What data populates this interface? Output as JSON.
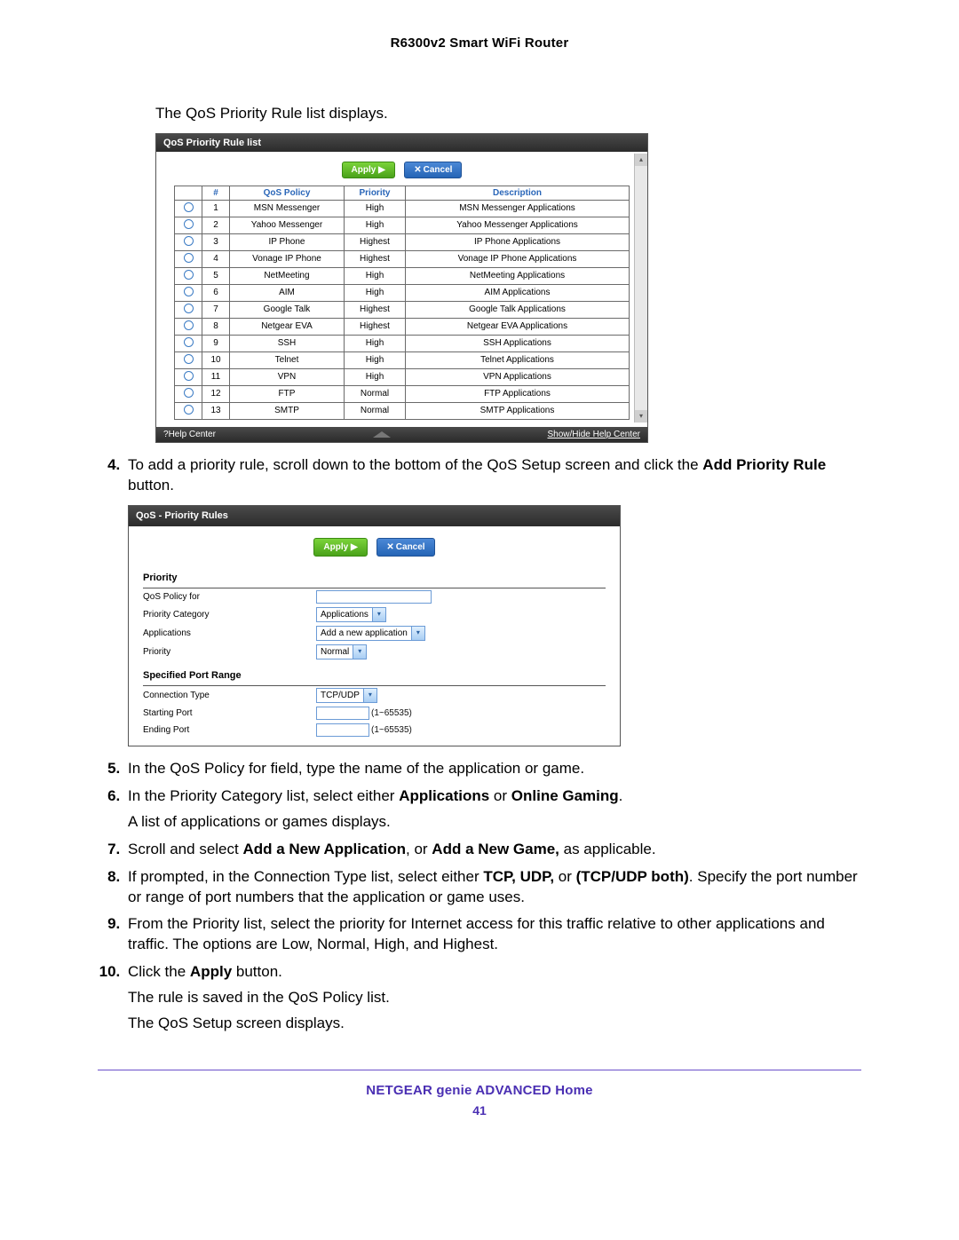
{
  "header": {
    "router_title": "R6300v2 Smart WiFi Router"
  },
  "intro": "The QoS Priority Rule list displays.",
  "shot1": {
    "title": "QoS Priority Rule list",
    "apply": "Apply ▶",
    "cancel": "Cancel",
    "cols": {
      "num": "#",
      "policy": "QoS Policy",
      "priority": "Priority",
      "desc": "Description"
    },
    "rows": [
      {
        "n": "1",
        "policy": "MSN Messenger",
        "pri": "High",
        "desc": "MSN Messenger Applications"
      },
      {
        "n": "2",
        "policy": "Yahoo Messenger",
        "pri": "High",
        "desc": "Yahoo Messenger Applications"
      },
      {
        "n": "3",
        "policy": "IP Phone",
        "pri": "Highest",
        "desc": "IP Phone Applications"
      },
      {
        "n": "4",
        "policy": "Vonage IP Phone",
        "pri": "Highest",
        "desc": "Vonage IP Phone Applications"
      },
      {
        "n": "5",
        "policy": "NetMeeting",
        "pri": "High",
        "desc": "NetMeeting Applications"
      },
      {
        "n": "6",
        "policy": "AIM",
        "pri": "High",
        "desc": "AIM Applications"
      },
      {
        "n": "7",
        "policy": "Google Talk",
        "pri": "Highest",
        "desc": "Google Talk Applications"
      },
      {
        "n": "8",
        "policy": "Netgear EVA",
        "pri": "Highest",
        "desc": "Netgear EVA Applications"
      },
      {
        "n": "9",
        "policy": "SSH",
        "pri": "High",
        "desc": "SSH Applications"
      },
      {
        "n": "10",
        "policy": "Telnet",
        "pri": "High",
        "desc": "Telnet Applications"
      },
      {
        "n": "11",
        "policy": "VPN",
        "pri": "High",
        "desc": "VPN Applications"
      },
      {
        "n": "12",
        "policy": "FTP",
        "pri": "Normal",
        "desc": "FTP Applications"
      },
      {
        "n": "13",
        "policy": "SMTP",
        "pri": "Normal",
        "desc": "SMTP Applications"
      }
    ],
    "help_center": "Help Center",
    "show_hide": "Show/Hide Help Center"
  },
  "step4": {
    "pre": "To add a priority rule, scroll down to the bottom of the QoS Setup screen and click the ",
    "bold": "Add Priority Rule",
    "post": " button."
  },
  "shot2": {
    "title": "QoS - Priority Rules",
    "apply": "Apply ▶",
    "cancel": "Cancel",
    "priority_heading": "Priority",
    "qos_policy_for": "QoS Policy for",
    "priority_category": "Priority Category",
    "applications_lbl": "Applications",
    "priority_lbl": "Priority",
    "sel_applications": "Applications",
    "sel_addnew": "Add a new application",
    "sel_normal": "Normal",
    "port_heading": "Specified Port Range",
    "conn_type": "Connection Type",
    "sel_tcpudp": "TCP/UDP",
    "starting_port": "Starting Port",
    "ending_port": "Ending Port",
    "port_hint": "(1~65535)"
  },
  "step5": "In the QoS Policy for field, type the name of the application or game.",
  "step6": {
    "pre": "In the Priority Category list, select either ",
    "b1": "Applications",
    "mid": " or ",
    "b2": "Online Gaming",
    "post": "."
  },
  "step6_sub": "A list of applications or games displays.",
  "step7": {
    "pre": "Scroll and select ",
    "b1": "Add a New Application",
    "mid": ", or ",
    "b2": "Add a New Game,",
    "post": " as applicable."
  },
  "step8": {
    "pre": "If prompted, in the Connection Type list, select either ",
    "b1": "TCP, UDP,",
    "mid": " or ",
    "b2": "(TCP/UDP both)",
    "post": ". Specify the port number or range of port numbers that the application or game uses."
  },
  "step9": "From the Priority list, select the priority for Internet access for this traffic relative to other applications and traffic. The options are Low, Normal, High, and Highest.",
  "step10": {
    "pre": "Click the ",
    "b1": "Apply",
    "post": " button."
  },
  "step10_sub1": "The rule is saved in the QoS Policy list.",
  "step10_sub2": "The QoS Setup screen displays.",
  "footer": {
    "title": "NETGEAR genie ADVANCED Home",
    "page": "41"
  }
}
